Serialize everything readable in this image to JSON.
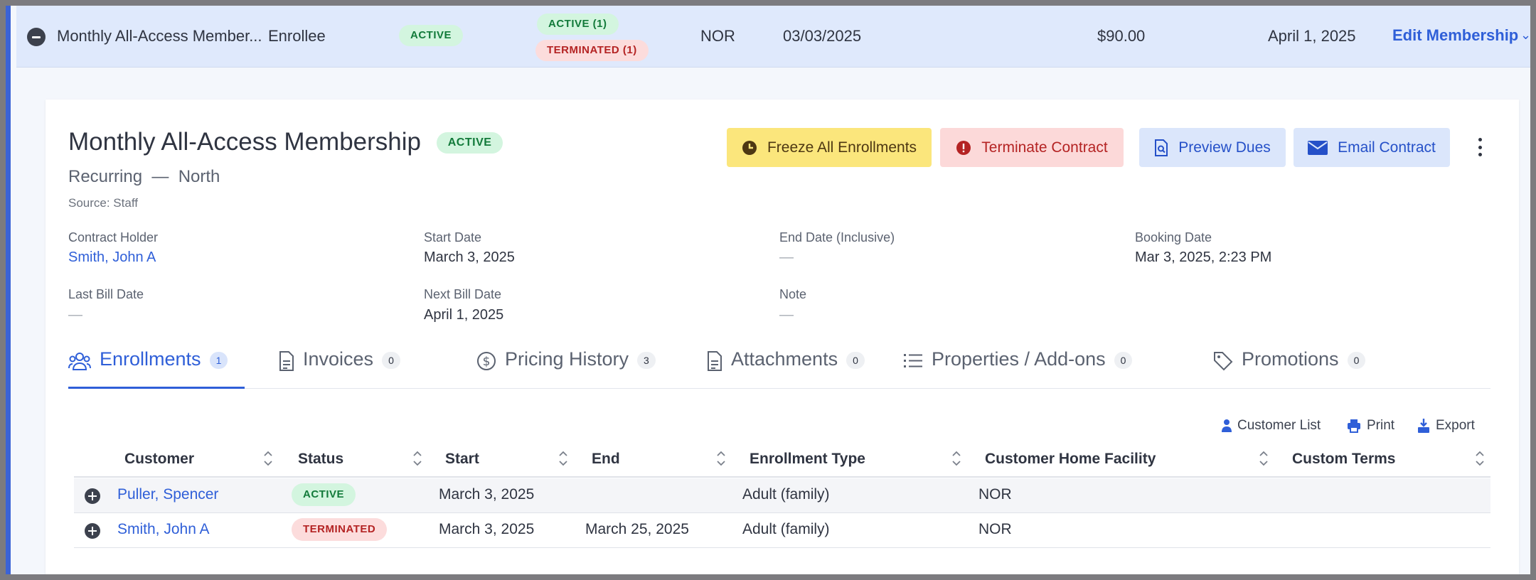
{
  "summary": {
    "plan_name": "Monthly All-Access Member...",
    "role": "Enrollee",
    "status": "ACTIVE",
    "status_active_count": "ACTIVE (1)",
    "status_terminated_count": "TERMINATED (1)",
    "facility": "NOR",
    "date": "03/03/2025",
    "amount": "$90.00",
    "next_date": "April 1, 2025",
    "edit_label": "Edit Membership"
  },
  "detail": {
    "title": "Monthly All-Access Membership",
    "status": "ACTIVE",
    "subtitle": "Recurring  —  North",
    "source": "Source: Staff",
    "actions": {
      "freeze": "Freeze All Enrollments",
      "terminate": "Terminate Contract",
      "preview": "Preview Dues",
      "email": "Email Contract"
    },
    "fields": {
      "contract_holder_label": "Contract Holder",
      "contract_holder": "Smith, John A",
      "start_date_label": "Start Date",
      "start_date": "March 3, 2025",
      "end_date_label": "End Date (Inclusive)",
      "end_date": "—",
      "booking_date_label": "Booking Date",
      "booking_date": "Mar 3, 2025, 2:23 PM",
      "last_bill_label": "Last Bill Date",
      "last_bill": "—",
      "next_bill_label": "Next Bill Date",
      "next_bill": "April 1, 2025",
      "note_label": "Note",
      "note": "—"
    }
  },
  "tabs": [
    {
      "label": "Enrollments",
      "count": "1"
    },
    {
      "label": "Invoices",
      "count": "0"
    },
    {
      "label": "Pricing History",
      "count": "3"
    },
    {
      "label": "Attachments",
      "count": "0"
    },
    {
      "label": "Properties / Add-ons",
      "count": "0"
    },
    {
      "label": "Promotions",
      "count": "0"
    }
  ],
  "toolbar": {
    "customer_list": "Customer List",
    "print": "Print",
    "export": "Export"
  },
  "table": {
    "columns": [
      "Customer",
      "Status",
      "Start",
      "End",
      "Enrollment Type",
      "Customer Home Facility",
      "Custom Terms"
    ],
    "rows": [
      {
        "customer": "Puller, Spencer",
        "status": "ACTIVE",
        "start": "March 3, 2025",
        "end": "",
        "type": "Adult (family)",
        "facility": "NOR",
        "terms": ""
      },
      {
        "customer": "Smith, John A",
        "status": "TERMINATED",
        "start": "March 3, 2025",
        "end": "March 25, 2025",
        "type": "Adult (family)",
        "facility": "NOR",
        "terms": ""
      }
    ]
  },
  "colors": {
    "accent": "#3b63d6",
    "active_bg": "#d3f5df",
    "terminated_bg": "#fcdcdc",
    "freeze_bg": "#fbe67c"
  }
}
